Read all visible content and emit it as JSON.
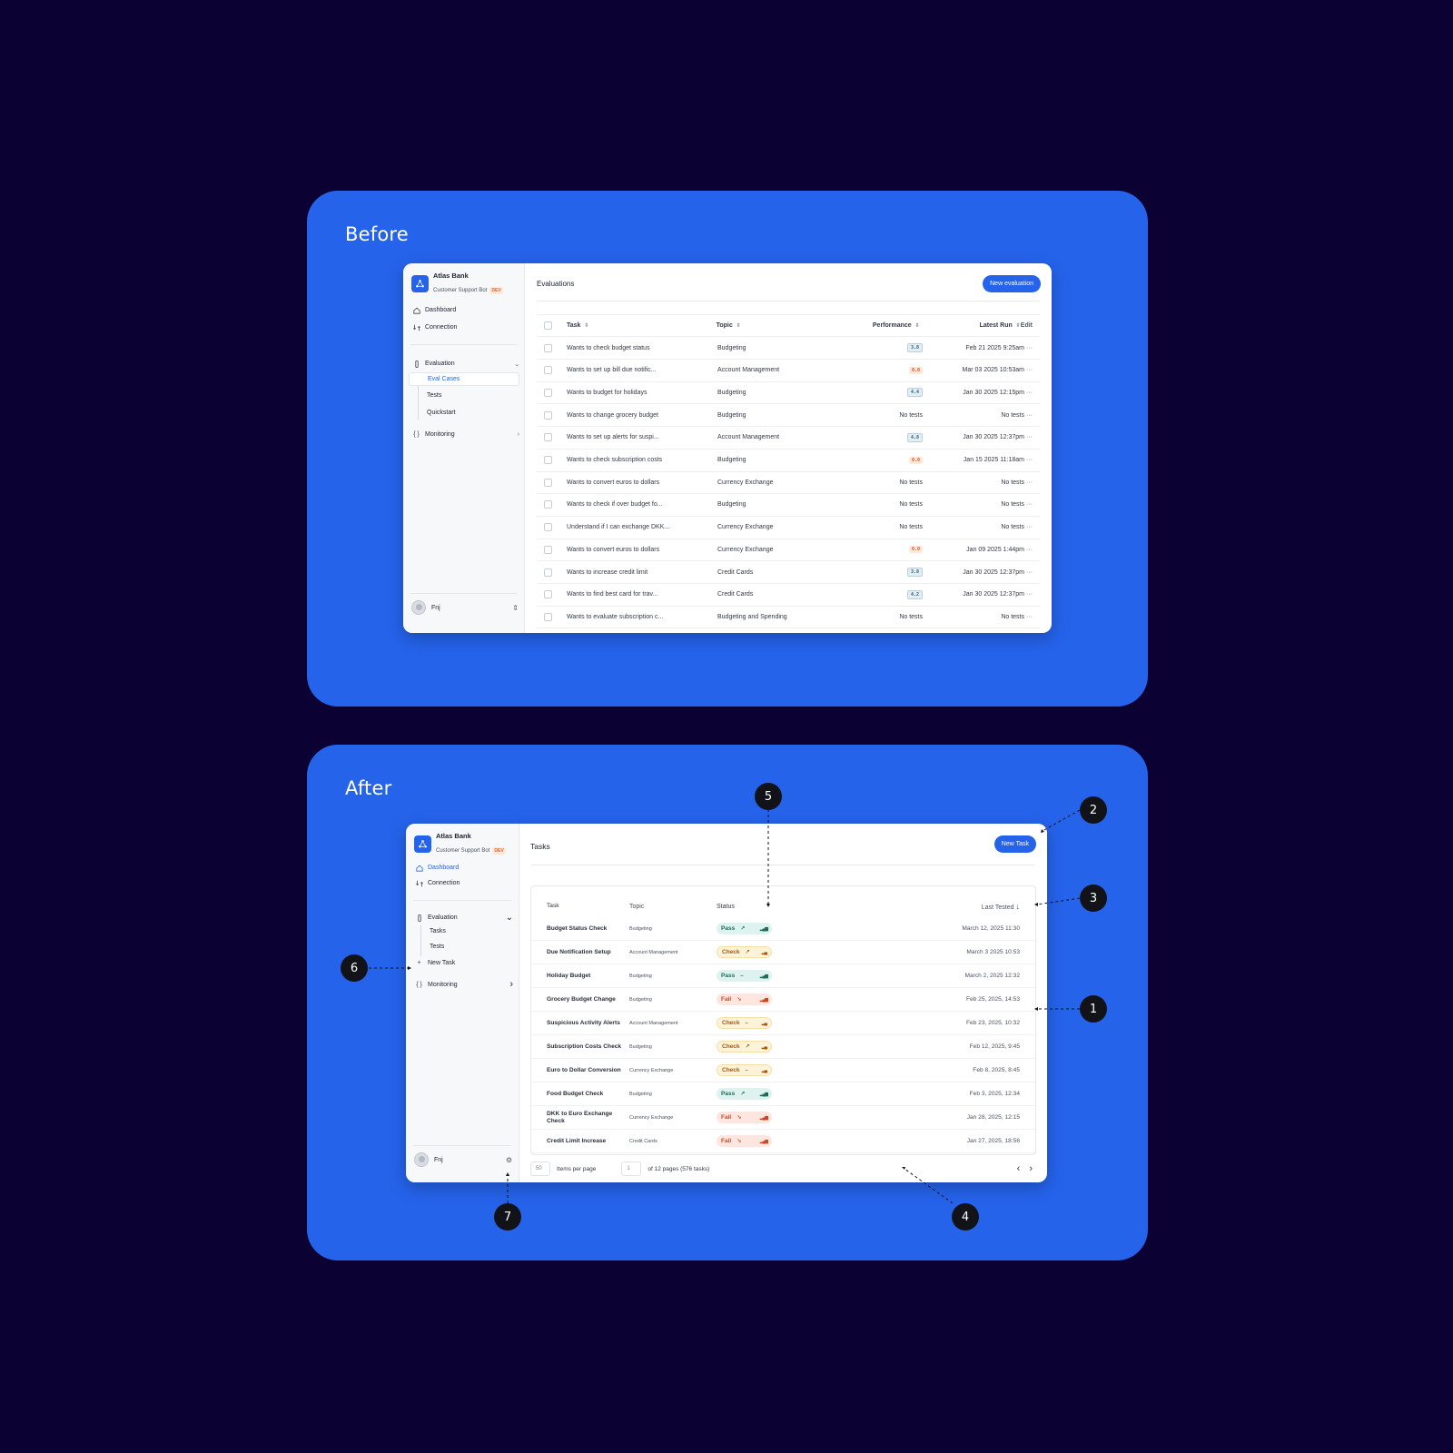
{
  "before": {
    "heading": "Before",
    "brand": {
      "name": "Atlas Bank",
      "subtitle": "Customer Support Bot",
      "badge": "DEV"
    },
    "nav": {
      "dashboard": "Dashboard",
      "connection": "Connection",
      "evaluation": "Evaluation",
      "monitoring": "Monitoring"
    },
    "subnav": {
      "eval_cases": "Eval Cases",
      "tests": "Tests",
      "quickstart": "Quickstart"
    },
    "user": "Fnj",
    "page_title": "Evaluations",
    "primary_button": "New evaluation",
    "columns": {
      "task": "Task",
      "topic": "Topic",
      "performance": "Performance",
      "latest_run": "Latest Run",
      "edit": "Edit"
    },
    "rows": [
      {
        "task": "Wants to check budget status",
        "topic": "Budgeting",
        "perf": "3.8",
        "perf_state": "ok",
        "run": "Feb 21 2025 9:25am"
      },
      {
        "task": "Wants to set up bill due notific...",
        "topic": "Account Management",
        "perf": "0.0",
        "perf_state": "bad",
        "run": "Mar 03 2025 10:53am"
      },
      {
        "task": "Wants to budget for holidays",
        "topic": "Budgeting",
        "perf": "4.4",
        "perf_state": "ok",
        "run": "Jan 30 2025 12:15pm"
      },
      {
        "task": "Wants to change grocery budget",
        "topic": "Budgeting",
        "perf": "No tests",
        "perf_state": "none",
        "run": "No tests"
      },
      {
        "task": "Wants to set up alerts for suspi...",
        "topic": "Account Management",
        "perf": "4.8",
        "perf_state": "ok",
        "run": "Jan 30 2025 12:37pm"
      },
      {
        "task": "Wants to check subscription costs",
        "topic": "Budgeting",
        "perf": "0.0",
        "perf_state": "bad",
        "run": "Jan 15 2025 11:18am"
      },
      {
        "task": "Wants to convert euros to dollars",
        "topic": "Currency Exchange",
        "perf": "No tests",
        "perf_state": "none",
        "run": "No tests"
      },
      {
        "task": "Wants to check if over budget fo...",
        "topic": "Budgeting",
        "perf": "No tests",
        "perf_state": "none",
        "run": "No tests"
      },
      {
        "task": "Understand if I can exchange DKK...",
        "topic": "Currency Exchange",
        "perf": "No tests",
        "perf_state": "none",
        "run": "No tests"
      },
      {
        "task": "Wants to convert euros to dollars",
        "topic": "Currency Exchange",
        "perf": "0.0",
        "perf_state": "bad",
        "run": "Jan 09 2025 1:44pm"
      },
      {
        "task": "Wants to increase credit limit",
        "topic": "Credit Cards",
        "perf": "3.8",
        "perf_state": "ok",
        "run": "Jan 30 2025 12:37pm"
      },
      {
        "task": "Wants to find best card for trav...",
        "topic": "Credit Cards",
        "perf": "4.2",
        "perf_state": "ok",
        "run": "Jan 30 2025 12:37pm"
      },
      {
        "task": "Wants to evaluate subscription c...",
        "topic": "Budgeting and Spending",
        "perf": "No tests",
        "perf_state": "none",
        "run": "No tests"
      }
    ]
  },
  "after": {
    "heading": "After",
    "brand": {
      "name": "Atlas Bank",
      "subtitle": "Customer Support Bot",
      "badge": "DEV"
    },
    "nav": {
      "dashboard": "Dashboard",
      "connection": "Connection",
      "evaluation": "Evaluation",
      "new_task": "New Task",
      "monitoring": "Monitoring"
    },
    "subnav": {
      "tasks": "Tasks",
      "tests": "Tests"
    },
    "user": "Fnj",
    "page_title": "Tasks",
    "primary_button": "New Task",
    "columns": {
      "task": "Task",
      "topic": "Topic",
      "status": "Status",
      "last_tested": "Last Tested"
    },
    "rows": [
      {
        "task": "Budget Status Check",
        "topic": "Budgeting",
        "status": "Pass",
        "state": "pass",
        "trend": "↗",
        "date": "March 12, 2025 11:30"
      },
      {
        "task": "Due Notification Setup",
        "topic": "Account Management",
        "status": "Check",
        "state": "check",
        "trend": "↗",
        "date": "March 3 2025 10:53"
      },
      {
        "task": "Holiday Budget",
        "topic": "Budgeting",
        "status": "Pass",
        "state": "pass",
        "trend": "–",
        "date": "March 2, 2025 12:32"
      },
      {
        "task": "Grocery Budget Change",
        "topic": "Budgeting",
        "status": "Fail",
        "state": "fail",
        "trend": "↘",
        "date": "Feb 25, 2025, 14:53"
      },
      {
        "task": "Suspicious Activity Alerts",
        "topic": "Account Management",
        "status": "Check",
        "state": "check",
        "trend": "–",
        "date": "Feb 23, 2025, 10:32"
      },
      {
        "task": "Subscription Costs Check",
        "topic": "Budgeting",
        "status": "Check",
        "state": "check",
        "trend": "↗",
        "date": "Feb 12, 2025, 9:45"
      },
      {
        "task": "Euro to Dollar Conversion",
        "topic": "Currency Exchange",
        "status": "Check",
        "state": "check",
        "trend": "–",
        "date": "Feb 8, 2025, 8:45"
      },
      {
        "task": "Food Budget Check",
        "topic": "Budgeting",
        "status": "Pass",
        "state": "pass",
        "trend": "↗",
        "date": "Feb 3, 2025, 12:34"
      },
      {
        "task": "DKK to Euro Exchange Check",
        "topic": "Currency Exchange",
        "status": "Fail",
        "state": "fail",
        "trend": "↘",
        "date": "Jan 28, 2025, 12:15"
      },
      {
        "task": "Credit Limit Increase",
        "topic": "Credit Cards",
        "status": "Fail",
        "state": "fail",
        "trend": "↘",
        "date": "Jan 27, 2025, 18:56"
      }
    ],
    "pager": {
      "per_page_value": "50",
      "per_page_label": "Items per page",
      "page_value": "1",
      "of_pages": "of 12 pages (576 tasks)"
    },
    "markers": [
      "1",
      "2",
      "3",
      "4",
      "5",
      "6",
      "7"
    ]
  },
  "colors": {
    "background": "#0b0233",
    "panel": "#2563eb",
    "accent": "#2563eb",
    "pass": "#1d6b5c",
    "check": "#a6570d",
    "fail": "#c64a23"
  }
}
